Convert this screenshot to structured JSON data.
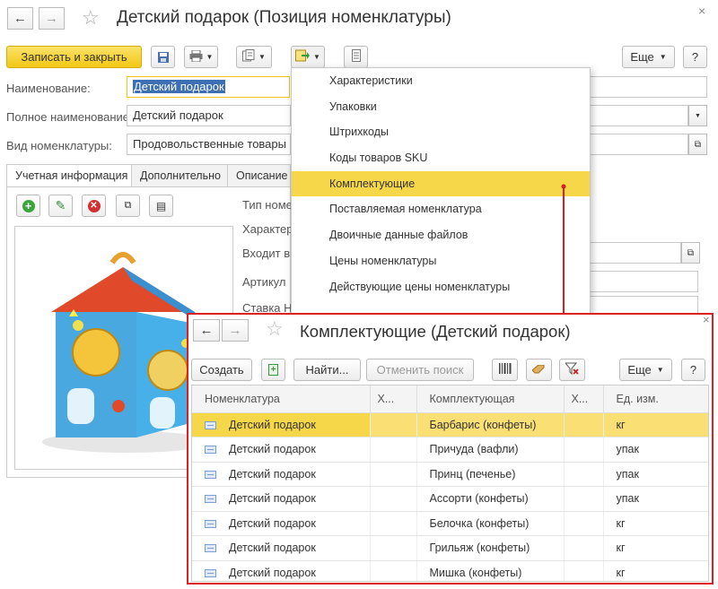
{
  "window": {
    "title": "Детский подарок (Позиция номенклатуры)",
    "save_close": "Записать и закрыть",
    "more": "Еще",
    "help": "?"
  },
  "form": {
    "name_label": "Наименование:",
    "name_value": "Детский подарок",
    "fullname_label": "Полное наименование:",
    "fullname_value": "Детский подарок",
    "kind_label": "Вид номенклатуры:",
    "kind_value": "Продовольственные товары"
  },
  "tabs": [
    "Учетная информация",
    "Дополнительно",
    "Описание"
  ],
  "side_labels": [
    "Тип номе",
    "Характер",
    "Входит в",
    "Артикул",
    "Ставка Н"
  ],
  "menu": {
    "items": [
      "Характеристики",
      "Упаковки",
      "Штрихкоды",
      "Коды товаров SKU",
      "Комплектующие",
      "Поставляемая номенклатура",
      "Двоичные данные файлов",
      "Цены номенклатуры",
      "Действующие цены номенклатуры"
    ],
    "highlighted": 4
  },
  "subwindow": {
    "title": "Комплектующие (Детский подарок)",
    "create": "Создать",
    "find": "Найти...",
    "cancel_search": "Отменить поиск",
    "more": "Еще",
    "help": "?",
    "columns": [
      "Номенклатура",
      "Х...",
      "Комплектующая",
      "Х...",
      "Ед. изм."
    ],
    "rows": [
      {
        "item": "Детский подарок",
        "component": "Барбарис (конфеты)",
        "unit": "кг"
      },
      {
        "item": "Детский подарок",
        "component": "Причуда (вафли)",
        "unit": "упак"
      },
      {
        "item": "Детский подарок",
        "component": "Принц (печенье)",
        "unit": "упак"
      },
      {
        "item": "Детский подарок",
        "component": "Ассорти (конфеты)",
        "unit": "упак"
      },
      {
        "item": "Детский подарок",
        "component": "Белочка (конфеты)",
        "unit": "кг"
      },
      {
        "item": "Детский подарок",
        "component": "Грильяж (конфеты)",
        "unit": "кг"
      },
      {
        "item": "Детский подарок",
        "component": "Мишка (конфеты)",
        "unit": "кг"
      }
    ]
  },
  "colors": {
    "accent_yellow": "#f7d74a",
    "highlight_red": "#e02020"
  }
}
